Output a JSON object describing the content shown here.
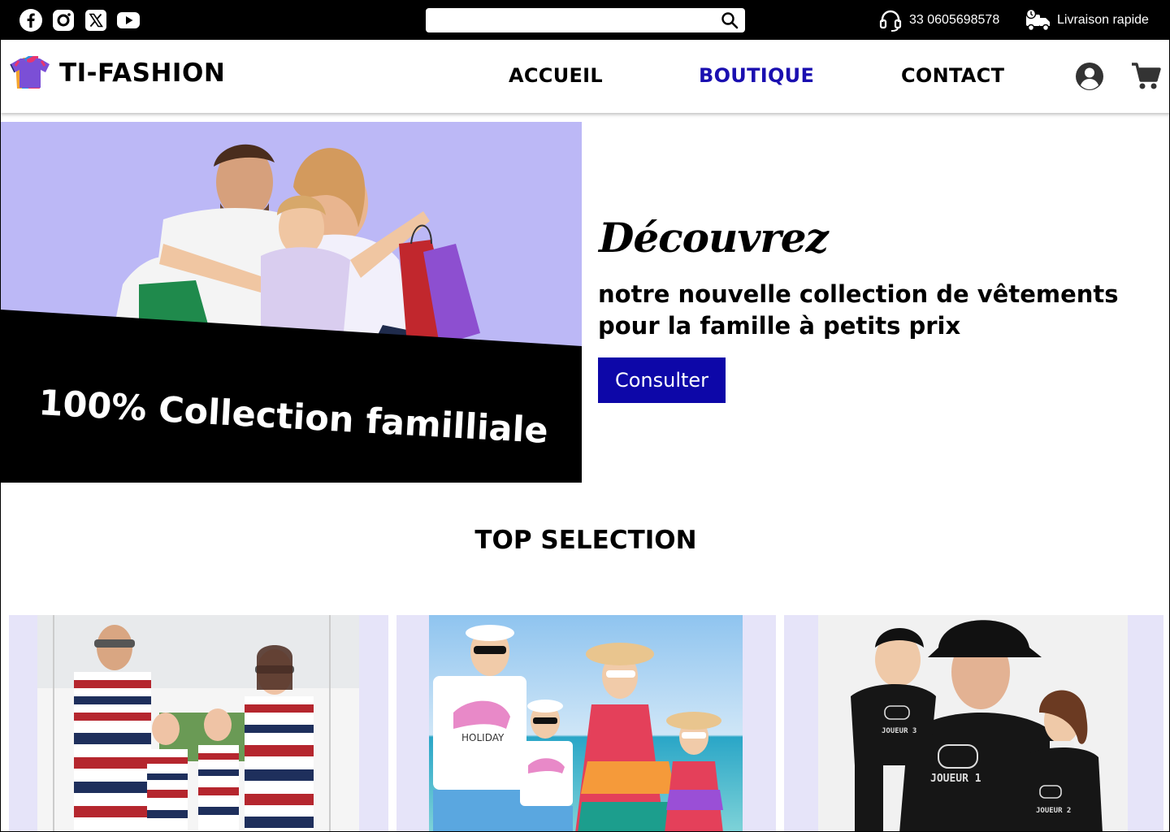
{
  "topbar": {
    "social_icons": [
      "facebook-icon",
      "instagram-icon",
      "x-icon",
      "youtube-icon"
    ],
    "search": {
      "placeholder": "",
      "value": ""
    },
    "phone": "33 0605698578",
    "delivery": "Livraison rapide"
  },
  "nav": {
    "logo_text": "TI-FASHION",
    "items": [
      {
        "label": "ACCUEIL",
        "active": false
      },
      {
        "label": "BOUTIQUE",
        "active": true
      },
      {
        "label": "CONTACT",
        "active": false
      }
    ]
  },
  "hero": {
    "caption": "100% Collection familliale",
    "heading_script": "Découvrez",
    "text": "notre nouvelle collection de vêtements pour la famille à petits prix",
    "cta_label": "Consulter"
  },
  "top_selection": {
    "title": "TOP SELECTION",
    "cards": [
      {
        "print": ""
      },
      {
        "print": "HOLIDAY"
      },
      {
        "print": "JOUEUR 1"
      }
    ]
  },
  "colors": {
    "accent": "#0d07a8",
    "active_nav": "#1a0fb0",
    "hero_bg": "#bcb8f6",
    "card_bg": "#e6e4f9"
  }
}
